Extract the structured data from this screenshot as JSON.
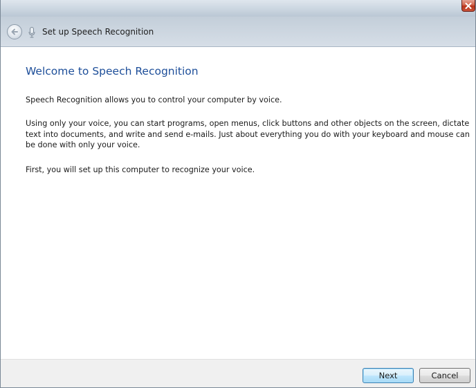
{
  "window": {
    "nav_title": "Set up Speech Recognition"
  },
  "icons": {
    "close": "close-icon",
    "back": "back-arrow-icon",
    "mic": "microphone-icon"
  },
  "content": {
    "heading": "Welcome to Speech Recognition",
    "paragraph1": "Speech Recognition allows you to control your computer by voice.",
    "paragraph2": "Using only your voice, you can start programs, open menus, click buttons and other objects on the screen, dictate text into documents, and write and send e-mails. Just about everything you do with your keyboard and mouse can be done with only your voice.",
    "paragraph3": "First, you will set up this computer to recognize your voice."
  },
  "footer": {
    "next_label": "Next",
    "cancel_label": "Cancel"
  },
  "colors": {
    "heading": "#1d4e99",
    "close_button": "#c8533a"
  }
}
